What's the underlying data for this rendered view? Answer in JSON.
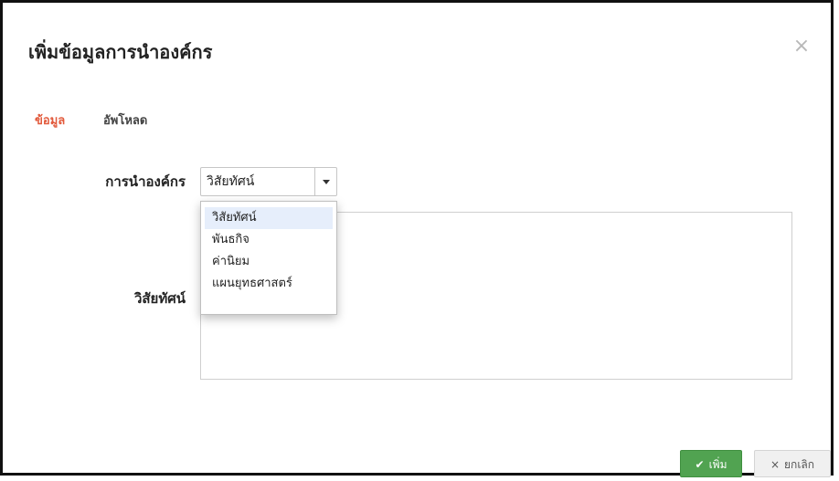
{
  "modal": {
    "title": "เพิ่มข้อมูลการนำองค์กร",
    "close_symbol": "×"
  },
  "tabs": [
    {
      "label": "ข้อมูล",
      "active": true
    },
    {
      "label": "อัพโหลด",
      "active": false
    }
  ],
  "form": {
    "type_label": "การนำองค์กร",
    "type_selected": "วิสัยทัศน์",
    "type_options": [
      "วิสัยทัศน์",
      "พันธกิจ",
      "ค่านิยม",
      "แผนยุทธศาสตร์"
    ],
    "vision_label": "วิสัยทัศน์",
    "vision_value": ""
  },
  "buttons": {
    "add_label": "เพิ่ม",
    "add_icon": "check-icon",
    "cancel_label": "ยกเลิก",
    "cancel_icon": "x-icon"
  },
  "colors": {
    "active_tab": "#e25a3c",
    "add_button": "#51a351",
    "cancel_button": "#f0f0f0",
    "selected_option_bg": "#e6eefb"
  }
}
